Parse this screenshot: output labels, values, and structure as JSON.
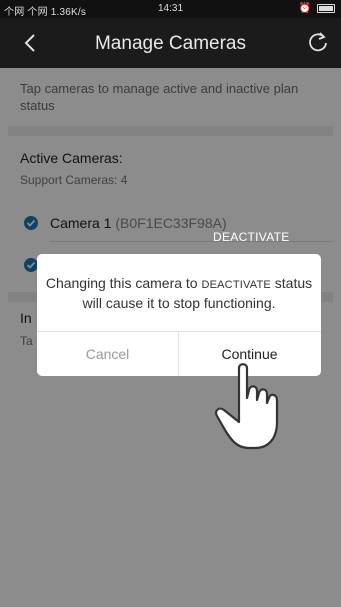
{
  "status_bar": {
    "signal_text": "个网 个网 1.36K/s",
    "time": "14:31"
  },
  "header": {
    "title": "Manage Cameras"
  },
  "main": {
    "hint": "Tap cameras to manage active and inactive plan status",
    "active_title": "Active Cameras:",
    "active_sub": "Support Cameras: 4",
    "cameras": [
      {
        "name": "Camera 1",
        "id": "(B0F1EC33F98A)"
      }
    ],
    "inactive_title": "In",
    "inactive_sub": "Ta"
  },
  "overlay_tag": "DEACTIVATE",
  "dialog": {
    "message_part1": "Changing this camera to ",
    "message_caps": "DEACTIVATE",
    "message_part2": " status will cause it to stop functioning.",
    "cancel_label": "Cancel",
    "continue_label": "Continue"
  },
  "colors": {
    "accent": "#1e78b8",
    "navbar": "#1b1b1b"
  },
  "icons": [
    "back-icon",
    "refresh-icon",
    "checkmark-icon",
    "pointing-hand-icon",
    "battery-icon",
    "wifi-icon"
  ]
}
